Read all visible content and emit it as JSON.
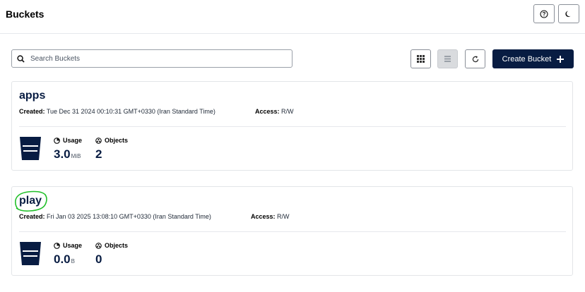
{
  "header": {
    "title": "Buckets"
  },
  "toolbar": {
    "search_placeholder": "Search Buckets",
    "create_label": "Create Bucket"
  },
  "labels": {
    "created": "Created:",
    "access": "Access:",
    "usage": "Usage",
    "objects": "Objects"
  },
  "buckets": [
    {
      "name": "apps",
      "created": "Tue Dec 31 2024 00:10:31 GMT+0330 (Iran Standard Time)",
      "access": "R/W",
      "usage_value": "3.0",
      "usage_unit": "MiB",
      "objects": "2"
    },
    {
      "name": "play",
      "created": "Fri Jan 03 2025 13:08:10 GMT+0330 (Iran Standard Time)",
      "access": "R/W",
      "usage_value": "0.0",
      "usage_unit": "B",
      "objects": "0"
    }
  ],
  "colors": {
    "primary": "#081c42",
    "highlight": "#22c02a",
    "border": "#e3e5e8"
  }
}
